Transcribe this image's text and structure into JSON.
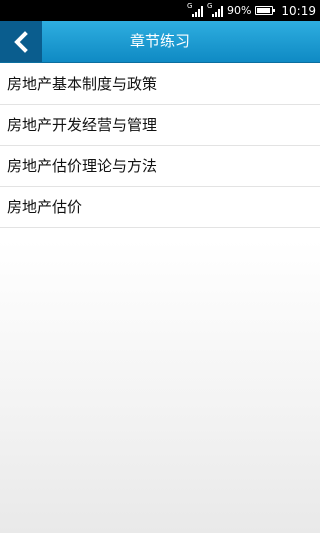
{
  "status_bar": {
    "sim1_label": "G",
    "sim2_label": "G",
    "battery_percent": "90%",
    "battery_level": 0.9,
    "time": "10:19"
  },
  "header": {
    "back_icon": "chevron-left-icon",
    "title": "章节练习",
    "accent_color": "#1a9bd3",
    "back_bg_color": "#0a5d8e"
  },
  "chapters": [
    {
      "label": "房地产基本制度与政策"
    },
    {
      "label": "房地产开发经营与管理"
    },
    {
      "label": "房地产估价理论与方法"
    },
    {
      "label": "房地产估价"
    }
  ]
}
